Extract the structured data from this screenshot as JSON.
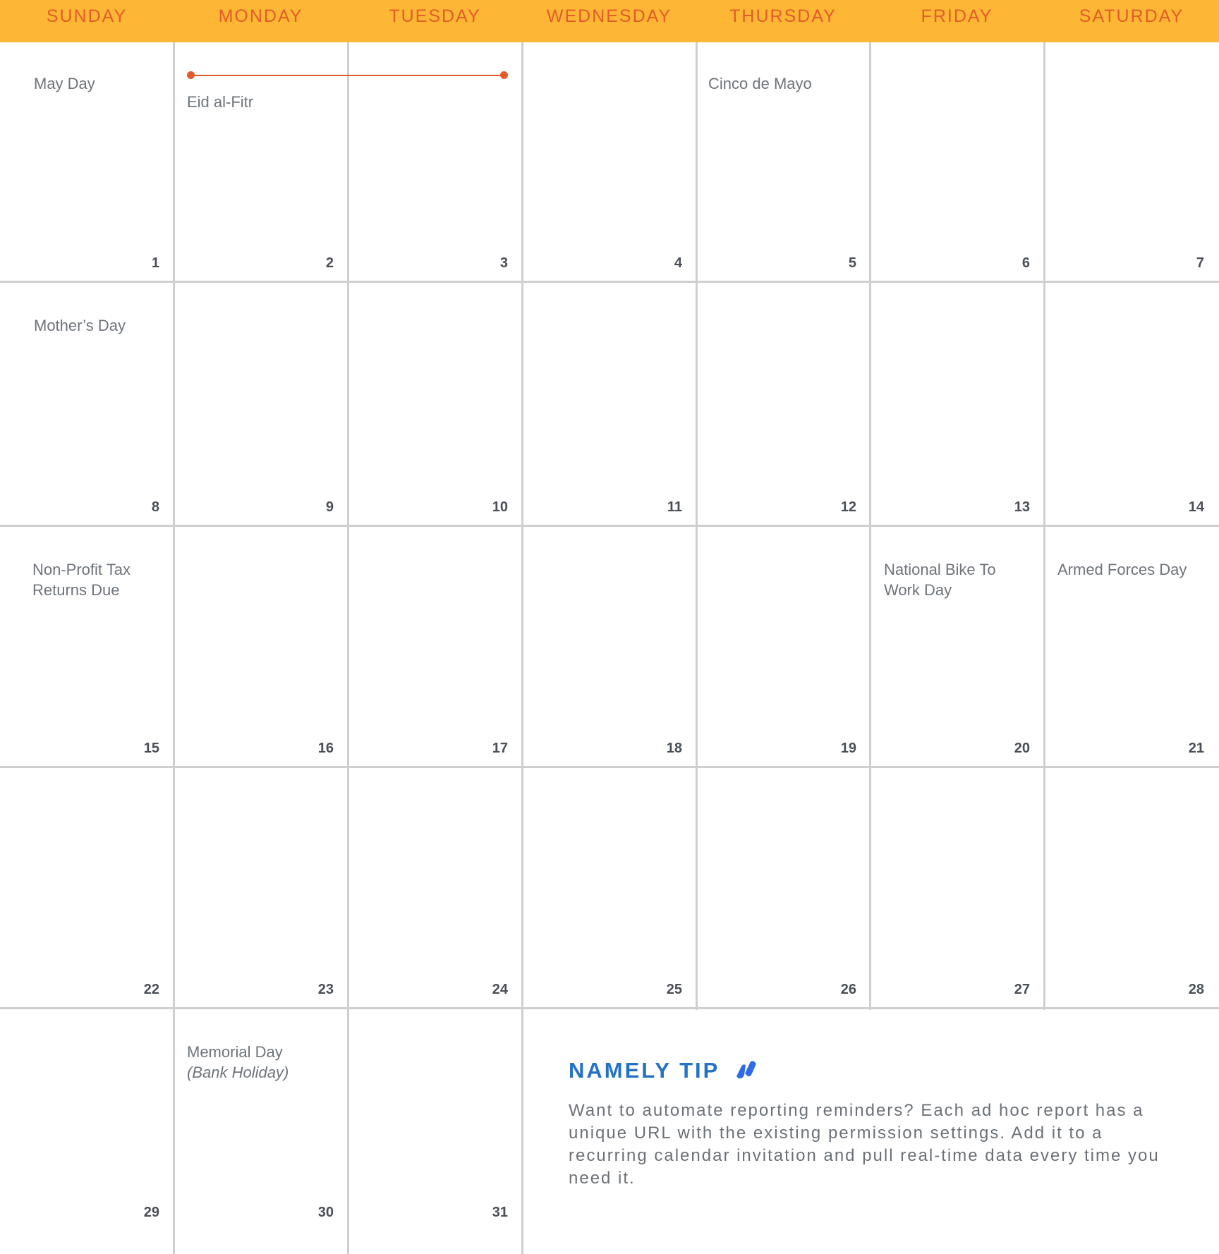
{
  "header": {
    "days": [
      "SUNDAY",
      "MONDAY",
      "TUESDAY",
      "WEDNESDAY",
      "THURSDAY",
      "FRIDAY",
      "SATURDAY"
    ]
  },
  "colors": {
    "header_bg": "#FDB734",
    "day_text": "#E35C28",
    "event_bar": "#E35C28",
    "tip_title": "#2472C7",
    "grid_lines": "#CFCFCF"
  },
  "weeks": [
    [
      "1",
      "2",
      "3",
      "4",
      "5",
      "6",
      "7"
    ],
    [
      "8",
      "9",
      "10",
      "11",
      "12",
      "13",
      "14"
    ],
    [
      "15",
      "16",
      "17",
      "18",
      "19",
      "20",
      "21"
    ],
    [
      "22",
      "23",
      "24",
      "25",
      "26",
      "27",
      "28"
    ],
    [
      "29",
      "30",
      "31"
    ]
  ],
  "events": {
    "may_day": "May Day",
    "eid": "Eid al-Fitr",
    "cinco": "Cinco de Mayo",
    "mothers_day": "Mother’s Day",
    "nonprofit_line1": "Non-Profit Tax",
    "nonprofit_line2": "Returns Due",
    "bike_line1": "National Bike To",
    "bike_line2": "Work Day",
    "armed_forces": "Armed Forces Day",
    "memorial": "Memorial Day",
    "memorial_sub": "(Bank Holiday)"
  },
  "tip": {
    "title": "NAMELY TIP",
    "icon": "namely-logo-icon",
    "body": "Want to automate reporting reminders? Each ad hoc report has a unique URL with the existing permission settings. Add it to a recurring calendar invitation and pull real-time data every time you need it."
  }
}
